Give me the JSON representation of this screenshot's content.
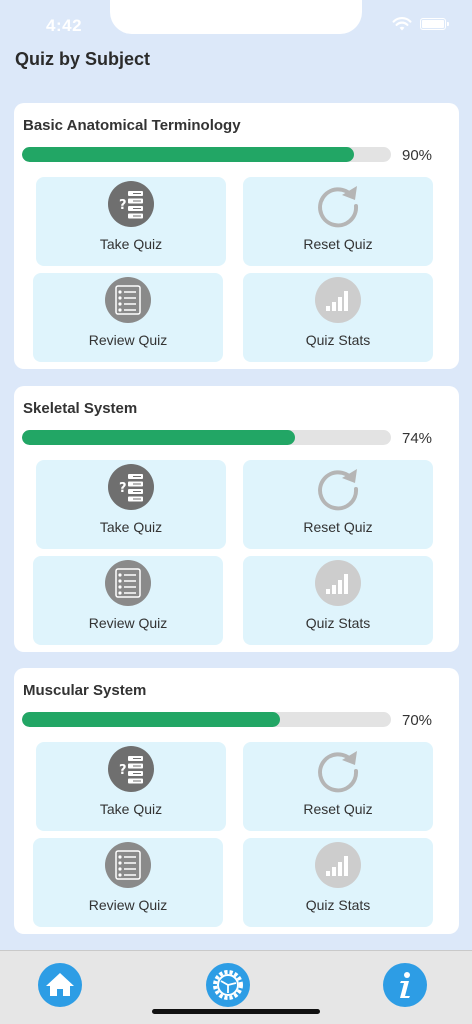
{
  "status_bar": {
    "time": "4:42"
  },
  "page": {
    "title": "Quiz by Subject"
  },
  "subjects": [
    {
      "title": "Basic Anatomical Terminology",
      "percent_label": "90%",
      "progress": 0.9,
      "tiles": {
        "take": "Take Quiz",
        "reset": "Reset Quiz",
        "review": "Review Quiz",
        "stats": "Quiz Stats"
      }
    },
    {
      "title": "Skeletal System",
      "percent_label": "74%",
      "progress": 0.74,
      "tiles": {
        "take": "Take Quiz",
        "reset": "Reset Quiz",
        "review": "Review Quiz",
        "stats": "Quiz Stats"
      }
    },
    {
      "title": "Muscular System",
      "percent_label": "70%",
      "progress": 0.7,
      "tiles": {
        "take": "Take Quiz",
        "reset": "Reset Quiz",
        "review": "Review Quiz",
        "stats": "Quiz Stats"
      }
    }
  ],
  "icons": {
    "take": "quiz-list-icon",
    "reset": "reset-arrow-icon",
    "review": "checklist-icon",
    "stats": "signal-bars-icon",
    "tab_home": "home-icon",
    "tab_settings": "gear-icon",
    "tab_info": "info-icon"
  },
  "colors": {
    "background": "#dce8f9",
    "progress_fill": "#22a665",
    "progress_track": "#e3e3e3",
    "tile_bg": "#dff4fc",
    "tab_accent": "#2d9de5",
    "icon_dark": "#6f6f6f",
    "icon_light": "#c9c9c9"
  }
}
